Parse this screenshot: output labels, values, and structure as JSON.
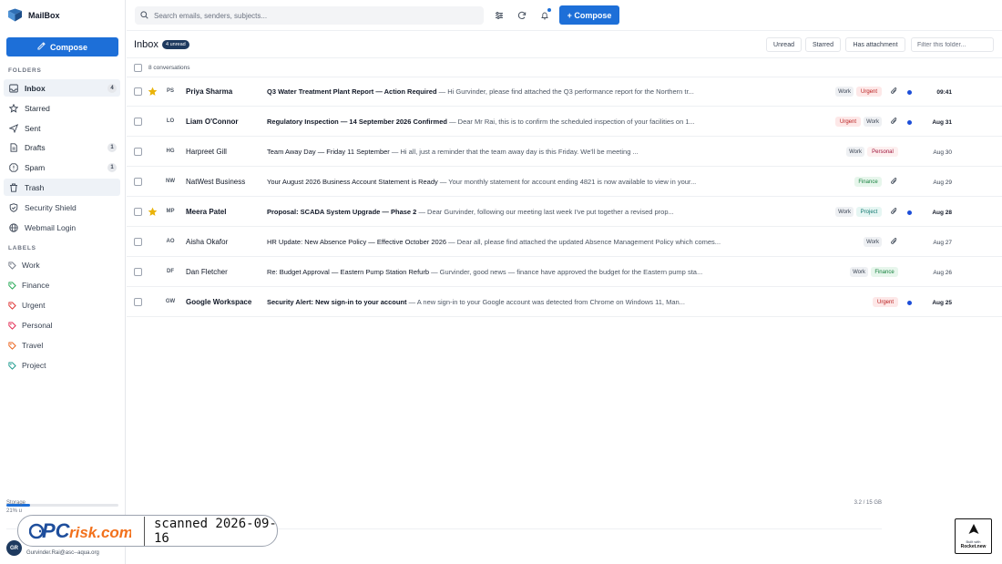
{
  "app": {
    "name": "MailBox"
  },
  "sidebar": {
    "compose_label": "Compose",
    "folders_heading": "FOLDERS",
    "folders": [
      {
        "label": "Inbox",
        "count": "4",
        "icon": "inbox-icon"
      },
      {
        "label": "Starred",
        "count": "",
        "icon": "star-icon"
      },
      {
        "label": "Sent",
        "count": "",
        "icon": "send-icon"
      },
      {
        "label": "Drafts",
        "count": "1",
        "icon": "file-icon"
      },
      {
        "label": "Spam",
        "count": "1",
        "icon": "alert-icon"
      },
      {
        "label": "Trash",
        "count": "",
        "icon": "trash-icon"
      },
      {
        "label": "Security Shield",
        "count": "",
        "icon": "shield-icon"
      },
      {
        "label": "Webmail Login",
        "count": "",
        "icon": "globe-icon"
      }
    ],
    "labels_heading": "LABELS",
    "labels": [
      {
        "label": "Work",
        "color": "#6b7280"
      },
      {
        "label": "Finance",
        "color": "#16a34a"
      },
      {
        "label": "Urgent",
        "color": "#dc2626"
      },
      {
        "label": "Personal",
        "color": "#e11d48"
      },
      {
        "label": "Travel",
        "color": "#ea580c"
      },
      {
        "label": "Project",
        "color": "#0d9488"
      }
    ],
    "storage": {
      "label": "Storage",
      "used": "3.2 / 15 GB",
      "percent_text": "21% u",
      "fraction": 0.21
    },
    "user": {
      "initials": "GR",
      "email": "Gurvinder.Rai@asc--aqua.org"
    }
  },
  "topbar": {
    "search_placeholder": "Search emails, senders, subjects...",
    "compose_label": "+ Compose"
  },
  "inbox": {
    "title": "Inbox",
    "unread_badge": "4 unread",
    "filters": [
      "Unread",
      "Starred",
      "Has attachment"
    ],
    "filter_placeholder": "Filter this folder...",
    "conversation_count": "8 conversations"
  },
  "emails": [
    {
      "initials": "PS",
      "sender": "Priya Sharma",
      "subject": "Q3 Water Treatment Plant Report — Action Required",
      "snippet": " — Hi Gurvinder, please find attached the Q3 performance report for the Northern tr...",
      "tags": [
        "Work",
        "Urgent"
      ],
      "date": "09:41",
      "starred": true,
      "unread": true,
      "attachment": true
    },
    {
      "initials": "LO",
      "sender": "Liam O'Connor",
      "subject": "Regulatory Inspection — 14 September 2026 Confirmed",
      "snippet": " — Dear Mr Rai, this is to confirm the scheduled inspection of your facilities on 1...",
      "tags": [
        "Urgent",
        "Work"
      ],
      "date": "Aug 31",
      "starred": false,
      "unread": true,
      "attachment": true
    },
    {
      "initials": "HG",
      "sender": "Harpreet Gill",
      "subject": "Team Away Day — Friday 11 September",
      "snippet": " — Hi all, just a reminder that the team away day is this Friday. We'll be meeting ...",
      "tags": [
        "Work",
        "Personal"
      ],
      "date": "Aug 30",
      "starred": false,
      "unread": false,
      "attachment": false
    },
    {
      "initials": "NW",
      "sender": "NatWest Business",
      "subject": "Your August 2026 Business Account Statement is Ready",
      "snippet": " — Your monthly statement for account ending 4821 is now available to view in your...",
      "tags": [
        "Finance"
      ],
      "date": "Aug 29",
      "starred": false,
      "unread": false,
      "attachment": true
    },
    {
      "initials": "MP",
      "sender": "Meera Patel",
      "subject": "Proposal: SCADA System Upgrade — Phase 2",
      "snippet": " — Dear Gurvinder, following our meeting last week I've put together a revised prop...",
      "tags": [
        "Work",
        "Project"
      ],
      "date": "Aug 28",
      "starred": true,
      "unread": true,
      "attachment": true
    },
    {
      "initials": "AO",
      "sender": "Aisha Okafor",
      "subject": "HR Update: New Absence Policy — Effective October 2026",
      "snippet": " — Dear all, please find attached the updated Absence Management Policy which comes...",
      "tags": [
        "Work"
      ],
      "date": "Aug 27",
      "starred": false,
      "unread": false,
      "attachment": true
    },
    {
      "initials": "DF",
      "sender": "Dan Fletcher",
      "subject": "Re: Budget Approval — Eastern Pump Station Refurb",
      "snippet": " — Gurvinder, good news — finance have approved the budget for the Eastern pump sta...",
      "tags": [
        "Work",
        "Finance"
      ],
      "date": "Aug 26",
      "starred": false,
      "unread": false,
      "attachment": false
    },
    {
      "initials": "GW",
      "sender": "Google Workspace",
      "subject": "Security Alert: New sign-in to your account",
      "snippet": " — A new sign-in to your Google account was detected from Chrome on Windows 11, Man...",
      "tags": [
        "Urgent"
      ],
      "date": "Aug 25",
      "starred": false,
      "unread": true,
      "attachment": false
    }
  ],
  "watermark": {
    "brand": "PCrisk.com",
    "text": "scanned 2026-09-16"
  },
  "badge": {
    "line1": "Built with",
    "line2": "Rocket.new"
  },
  "colors": {
    "accent": "#1d6fd8",
    "star": "#eab308",
    "unread_dot": "#1d4ed8"
  }
}
